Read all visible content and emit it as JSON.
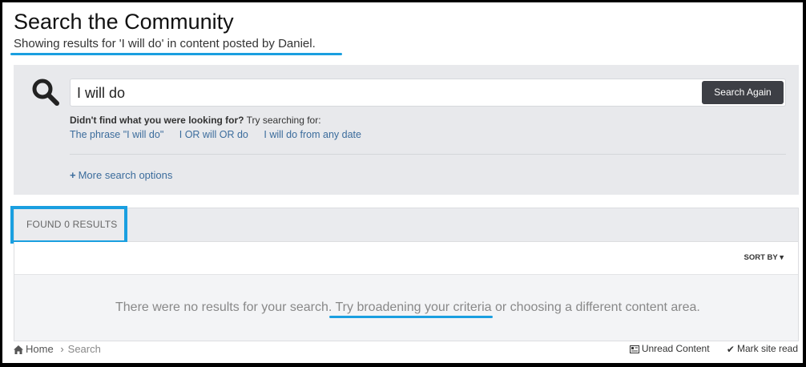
{
  "page": {
    "title": "Search the Community",
    "subtitle": "Showing results for 'I will do' in content posted by Daniel."
  },
  "search": {
    "value": "I will do",
    "button_label": "Search Again",
    "hint_bold": "Didn't find what you were looking for?",
    "hint_rest": " Try searching for:",
    "suggestions": [
      "The phrase \"I will do\"",
      "I OR will OR do",
      "I will do from any date"
    ],
    "more_options": "More search options",
    "icon": "search-icon"
  },
  "results": {
    "found_label": "FOUND 0 RESULTS",
    "sort_label": "SORT BY",
    "empty_part1": "There were no results for your search. ",
    "empty_link": "Try broadening your criteria",
    "empty_part2": " or choosing a different content area."
  },
  "breadcrumb": {
    "home": "Home",
    "current": "Search"
  },
  "footer": {
    "unread": "Unread Content",
    "mark_read": "Mark site read"
  },
  "colors": {
    "highlight": "#1a9fe0",
    "link": "#3b6c9c",
    "button": "#3d3f45"
  }
}
